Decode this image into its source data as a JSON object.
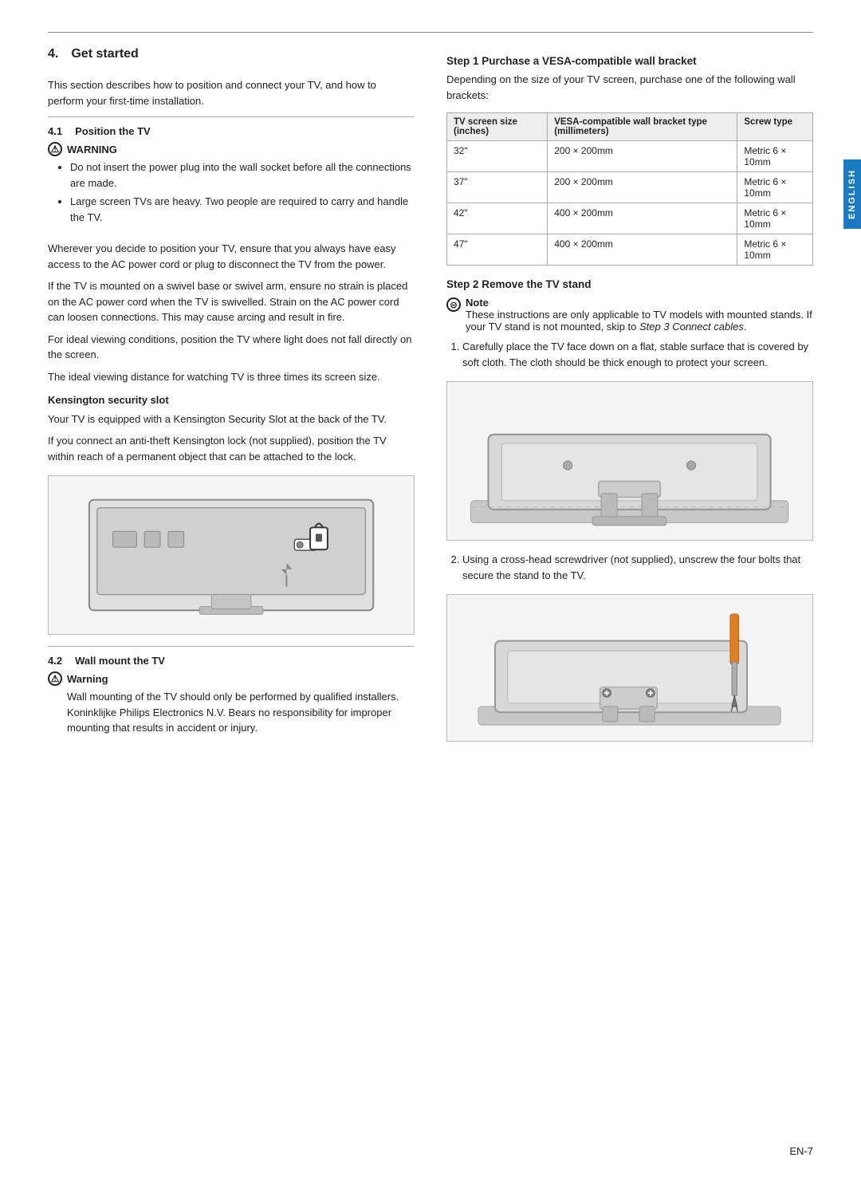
{
  "page": {
    "top_line": true,
    "section_number": "4.",
    "section_title": "Get started",
    "intro": "This section describes how to position and connect your TV, and how to perform your first-time installation.",
    "subsection_4_1_number": "4.1",
    "subsection_4_1_title": "Position the TV",
    "warning_title": "WARNING",
    "warning_items": [
      "Do not insert the power plug into the wall socket before all the connections are made.",
      "Large screen TVs are heavy. Two people are required to carry and handle the TV."
    ],
    "para1": "Wherever you decide to position your TV, ensure that you always have easy access to the AC power cord or plug to disconnect the TV from the power.",
    "para2": "If the TV is mounted on a swivel base or swivel arm, ensure no strain is placed on the AC power cord when the TV is swivelled. Strain on the AC power cord can loosen connections. This may cause arcing and result in fire.",
    "para3": "For ideal viewing conditions, position the TV where light does not fall directly on the screen.",
    "para4": "The ideal viewing distance for watching TV is three times its screen size.",
    "kensington_title": "Kensington security slot",
    "kensington_para1": "Your TV is equipped with a Kensington Security Slot at the back of the TV.",
    "kensington_para2": "If you connect an anti-theft Kensington lock (not supplied), position the TV within reach of a permanent object that can be attached to the lock.",
    "subsection_4_2_number": "4.2",
    "subsection_4_2_title": "Wall mount the TV",
    "warning2_title": "Warning",
    "warning2_text": "Wall mounting of the TV should only be performed by qualified installers. Koninklijke Philips Electronics N.V. Bears no responsibility for improper mounting that results in accident or injury.",
    "right_col": {
      "step1_heading": "Step 1 Purchase a VESA-compatible wall bracket",
      "step1_intro": "Depending on the size of your TV screen, purchase one of the following wall brackets:",
      "table": {
        "col1_header": "TV screen size (inches)",
        "col2_header": "VESA-compatible wall bracket type (millimeters)",
        "col3_header": "Screw type",
        "rows": [
          {
            "size": "32\"",
            "bracket": "200 × 200mm",
            "screw": "Metric 6 × 10mm"
          },
          {
            "size": "37\"",
            "bracket": "200 × 200mm",
            "screw": "Metric 6 × 10mm"
          },
          {
            "size": "42\"",
            "bracket": "400 × 200mm",
            "screw": "Metric 6 × 10mm"
          },
          {
            "size": "47\"",
            "bracket": "400 × 200mm",
            "screw": "Metric 6 × 10mm"
          }
        ]
      },
      "step2_heading": "Step 2 Remove the TV stand",
      "note_title": "Note",
      "note_text": "These instructions are only applicable to TV models with mounted stands. If your TV stand is not mounted, skip to",
      "note_italic": "Step 3 Connect cables",
      "step2_item1": "Carefully place the TV face down on a flat, stable surface that is covered by soft cloth. The cloth should be thick enough to protect your screen.",
      "step2_item2": "Using a cross-head screwdriver (not supplied), unscrew the four bolts that secure the stand to the TV."
    },
    "english_tab": "ENGLISH",
    "page_number": "EN-7"
  }
}
